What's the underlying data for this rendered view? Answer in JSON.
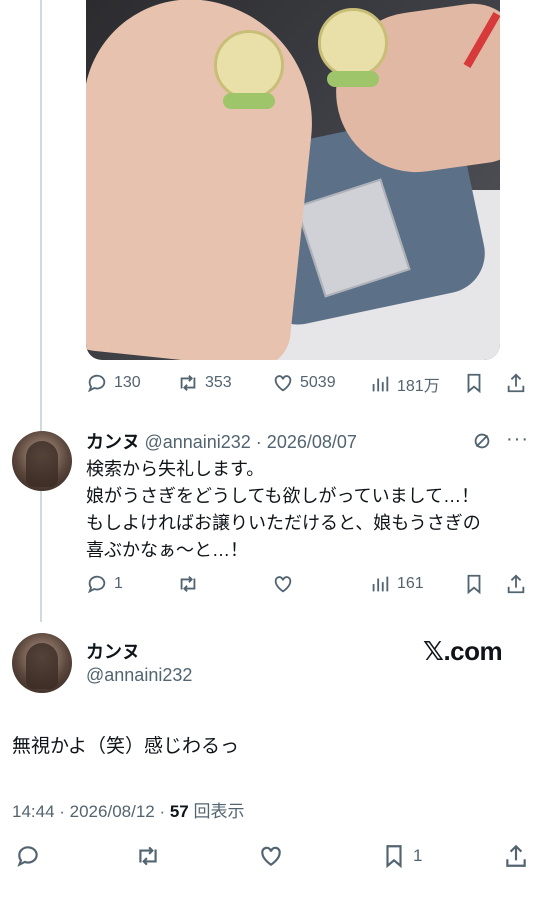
{
  "tweet1": {
    "actions": {
      "replies": "130",
      "retweets": "353",
      "likes": "5039",
      "views": "181万"
    }
  },
  "reply": {
    "display_name": "カンヌ",
    "handle_date": "@annaini232 · 2026/08/07",
    "text_lines": [
      "検索から失礼します。",
      "娘がうさぎをどうしても欲しがっていまして…！",
      "もしよければお譲りいただけると、娘もうさぎの",
      "喜ぶかなぁ～と…！"
    ],
    "actions": {
      "replies": "1",
      "retweets": "",
      "likes": "",
      "views": "161"
    }
  },
  "main": {
    "display_name": "カンヌ",
    "handle": "@annaini232",
    "logo_text": "𝕏.com",
    "text": "無視かよ（笑）感じわるっ",
    "timestamp": "14:44 · 2026/08/12 · ",
    "views_count": "57",
    "views_label": " 回表示",
    "actions": {
      "bookmarks": "1"
    }
  }
}
